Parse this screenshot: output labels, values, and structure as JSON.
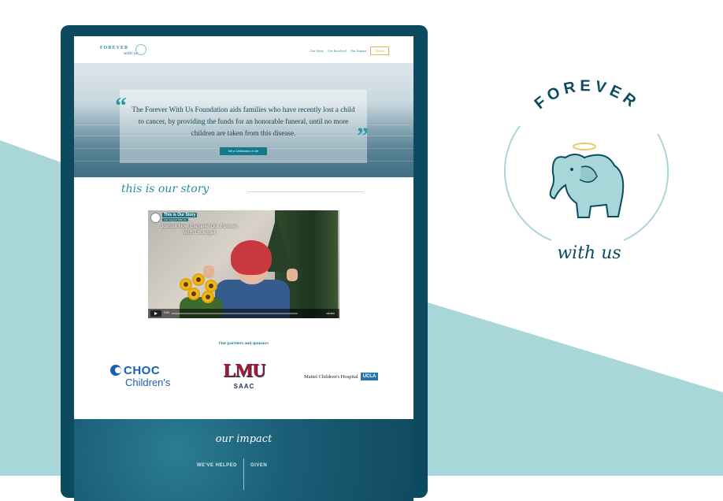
{
  "colors": {
    "teal_dark": "#0b4a5f",
    "teal_accent": "#2a8b9c",
    "mint_bg": "#a8d6d9",
    "gold": "#e0b64a"
  },
  "nav": {
    "logo_text_top": "FOREVER",
    "logo_text_bottom": "with us",
    "links": [
      "Our Story",
      "Get Involved",
      "Our Impact"
    ],
    "donate_label": "Donate"
  },
  "hero": {
    "quote": "The Forever With Us Foundation aids families who have recently lost a child to cancer, by providing the funds for an honorable funeral, until no more children are taken from this disease.",
    "button_label": "Gift a Celebration of Life"
  },
  "story": {
    "heading": "this is our story"
  },
  "video": {
    "title": "This is Our Story",
    "subtitle": "from Forever With Us",
    "caption": "Joshua Noel Esquivel Our Forever With Us Angel",
    "time": "3:04",
    "brand": "vimeo"
  },
  "partners": {
    "heading": "Our partners and sponsors",
    "choc_top": "CHOC",
    "choc_bottom": "Children's",
    "lmu_top": "LMU",
    "lmu_bottom": "SAAC",
    "mattel_text": "Mattel Children's Hospital",
    "mattel_badge": "UCLA"
  },
  "impact": {
    "heading": "our impact",
    "label_left": "WE'VE HELPED",
    "label_right": "GIVEN"
  },
  "big_logo": {
    "top_text": "FOREVER",
    "bottom_text": "with us",
    "icon": "elephant-with-halo-icon"
  }
}
